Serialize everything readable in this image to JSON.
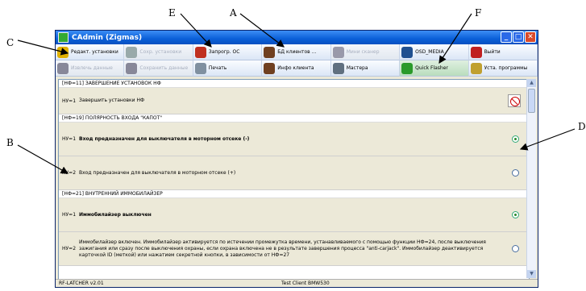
{
  "annotations": {
    "a": "A",
    "b": "B",
    "c": "C",
    "d": "D",
    "e": "E",
    "f": "F"
  },
  "window": {
    "title": "CAdmin (Zigmas)"
  },
  "toolbar": {
    "row1": [
      {
        "label": "Редакт. установки",
        "dim": false,
        "icon": "gears-icon",
        "color": "#e0b000"
      },
      {
        "label": "Сохр. установки",
        "dim": true,
        "icon": "save-gears-icon",
        "color": "#9aa"
      },
      {
        "label": "Запрогр. ОС",
        "dim": false,
        "icon": "program-device-icon",
        "color": "#c03020"
      },
      {
        "label": "БД клиентов ...",
        "dim": false,
        "icon": "clients-db-icon",
        "color": "#704020"
      },
      {
        "label": "Мини сканер",
        "dim": true,
        "icon": "scanner-icon",
        "color": "#99a"
      },
      {
        "label": "OSD_MEDIA",
        "dim": false,
        "icon": "media-icon",
        "color": "#205090"
      },
      {
        "label": "Выйти",
        "dim": false,
        "icon": "exit-icon",
        "color": "#c02020"
      }
    ],
    "row2": [
      {
        "label": "Извлечь данные",
        "dim": true,
        "icon": "extract-icon",
        "color": "#889"
      },
      {
        "label": "Сохранить данные",
        "dim": true,
        "icon": "save-data-icon",
        "color": "#889"
      },
      {
        "label": "Печать",
        "dim": false,
        "icon": "printer-icon",
        "color": "#8090a0"
      },
      {
        "label": "Инфо клиента",
        "dim": false,
        "icon": "client-info-icon",
        "color": "#704020"
      },
      {
        "label": "Мастера",
        "dim": false,
        "icon": "wizard-icon",
        "color": "#607080"
      },
      {
        "label": "Quick Flasher",
        "dim": false,
        "icon": "quick-flasher-icon",
        "color": "#2a9a2a"
      },
      {
        "label": "Уста. программы",
        "dim": false,
        "icon": "program-settings-icon",
        "color": "#c0a030"
      }
    ]
  },
  "sections": [
    {
      "header": "[НФ=11]  ЗАВЕРШЕНИЕ УСТАНОВОК НФ",
      "rows": [
        {
          "code": "НУ=1",
          "text": "Завершить установки НФ",
          "bold": false,
          "control": "nosign"
        }
      ]
    },
    {
      "header": "[НФ=19]  ПОЛЯРНОСТЬ ВХОДА \"КАПОТ\"",
      "rows": [
        {
          "code": "НУ=1",
          "text": "Вход предназначен для выключателя в моторном отсеке (-)",
          "bold": true,
          "control": "on"
        },
        {
          "code": "НУ=2",
          "text": "Вход предназначен для выключателя в моторном отсеке (+)",
          "bold": false,
          "control": "off"
        }
      ]
    },
    {
      "header": "[НФ=21]  ВНУТРЕННИЙ ИММОБИЛАЙЗЕР",
      "rows": [
        {
          "code": "НУ=1",
          "text": "Иммобилайзер выключен",
          "bold": true,
          "control": "on"
        },
        {
          "code": "НУ=2",
          "text": "Иммобилайзер включен. Иммобилайзер активируется по истечении промежутка времени, устанавливаемого с помощью функции НФ=24, после выключения зажигания или сразу после выключения охраны, если охрана включена не в результате завершения процесса \"anti-carjack\". Иммобилайзер деактивируется карточкой ID (меткой) или нажатием секретной кнопки, в зависимости от НФ=27",
          "bold": false,
          "control": "off"
        }
      ]
    }
  ],
  "statusbar": {
    "left": "RF-LATCHER v2.01",
    "mid": "Test Client  BMW530"
  }
}
